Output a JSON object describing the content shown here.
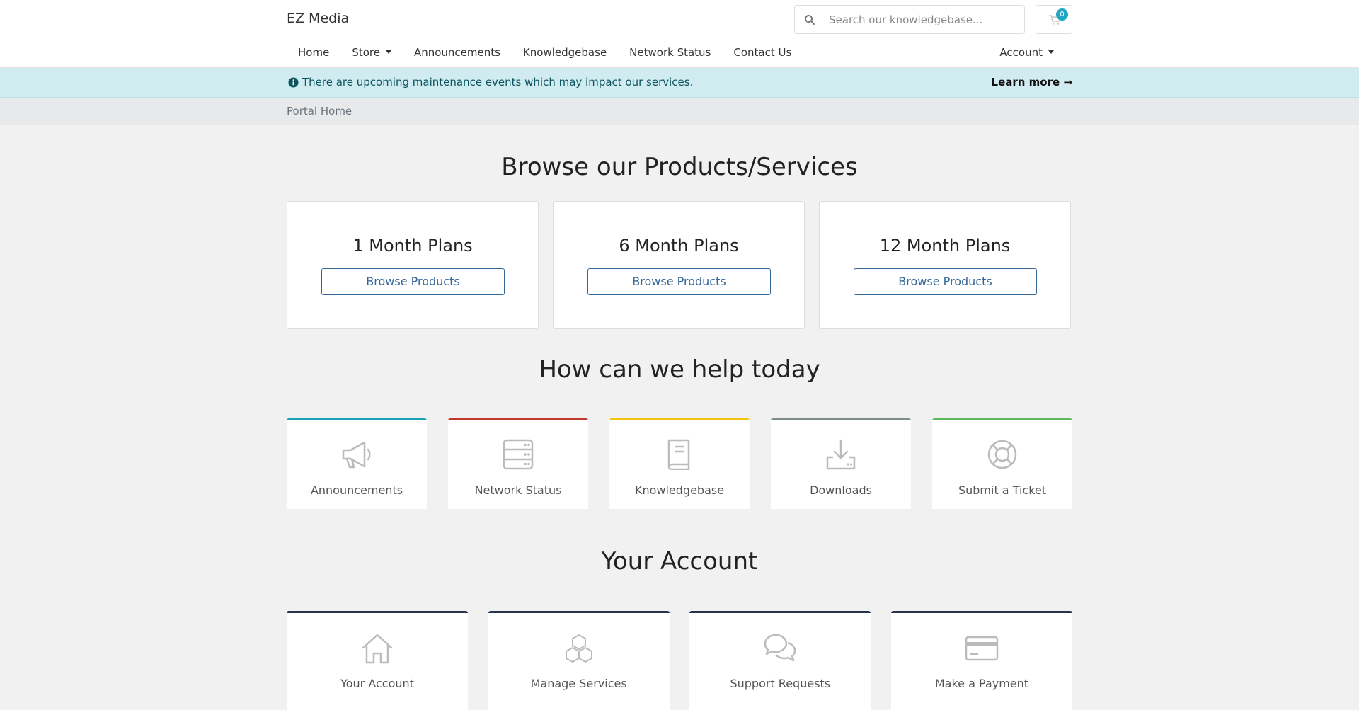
{
  "brand": {
    "name": "EZ Media"
  },
  "search": {
    "placeholder": "Search our knowledgebase..."
  },
  "cart": {
    "count": "0",
    "icon": "cart-icon"
  },
  "nav": {
    "items": [
      {
        "label": "Home"
      },
      {
        "label": "Store",
        "dropdown": true
      },
      {
        "label": "Announcements"
      },
      {
        "label": "Knowledgebase"
      },
      {
        "label": "Network Status"
      },
      {
        "label": "Contact Us"
      }
    ],
    "account_label": "Account"
  },
  "alert": {
    "message": "There are upcoming maintenance events which may impact our services.",
    "link_label": "Learn more",
    "link_arrow": "→",
    "color": "#d1ecf1"
  },
  "breadcrumb": {
    "current": "Portal Home"
  },
  "products": {
    "heading": "Browse our Products/Services",
    "plans": [
      {
        "title": "1 Month Plans",
        "button": "Browse Products"
      },
      {
        "title": "6 Month Plans",
        "button": "Browse Products"
      },
      {
        "title": "12 Month Plans",
        "button": "Browse Products"
      }
    ]
  },
  "help": {
    "heading": "How can we help today",
    "cards": [
      {
        "label": "Announcements",
        "icon": "megaphone-icon",
        "color": "#17a2b8"
      },
      {
        "label": "Network Status",
        "icon": "server-icon",
        "color": "#c0392b"
      },
      {
        "label": "Knowledgebase",
        "icon": "book-icon",
        "color": "#f1c40f"
      },
      {
        "label": "Downloads",
        "icon": "download-icon",
        "color": "#7f8c8d"
      },
      {
        "label": "Submit a Ticket",
        "icon": "lifebuoy-icon",
        "color": "#5cb85c"
      }
    ]
  },
  "account": {
    "heading": "Your Account",
    "cards": [
      {
        "label": "Your Account",
        "icon": "home-icon"
      },
      {
        "label": "Manage Services",
        "icon": "cubes-icon"
      },
      {
        "label": "Support Requests",
        "icon": "comments-icon"
      },
      {
        "label": "Make a Payment",
        "icon": "credit-card-icon"
      }
    ],
    "color": "#28344b"
  }
}
